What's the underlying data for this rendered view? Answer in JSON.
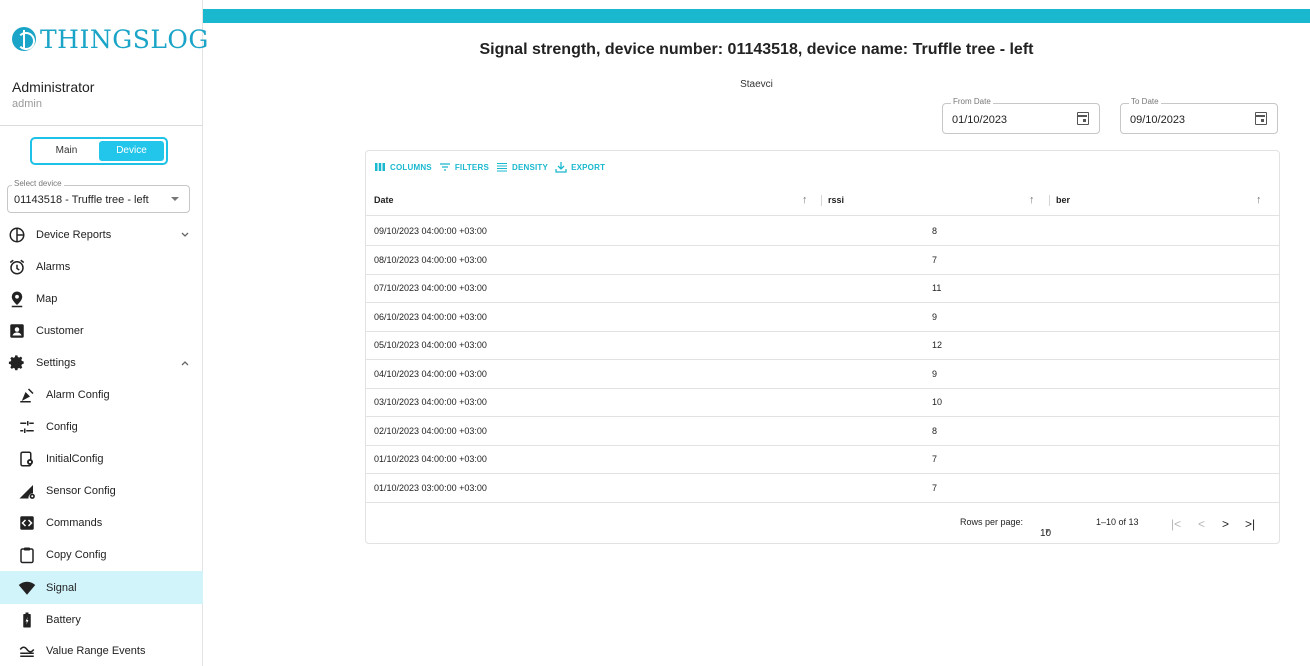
{
  "brand": {
    "name": "THINGSLOG"
  },
  "user": {
    "name": "Administrator",
    "login": "admin"
  },
  "mode_toggle": {
    "main_label": "Main",
    "device_label": "Device",
    "active": "Device"
  },
  "device_select": {
    "label": "Select device",
    "value": "01143518 - Truffle tree - left"
  },
  "nav": {
    "device_reports": "Device Reports",
    "alarms": "Alarms",
    "map": "Map",
    "customer": "Customer",
    "settings": "Settings",
    "alarm_config": "Alarm Config",
    "config": "Config",
    "initial_config": "InitialConfig",
    "sensor_config": "Sensor Config",
    "commands": "Commands",
    "copy_config": "Copy Config",
    "signal": "Signal",
    "battery": "Battery",
    "value_range_events": "Value Range Events"
  },
  "page": {
    "title": "Signal strength, device number: 01143518, device name: Truffle tree - left",
    "subtitle": "Staevci"
  },
  "filters": {
    "from_label": "From Date",
    "from_value": "01/10/2023",
    "to_label": "To Date",
    "to_value": "09/10/2023"
  },
  "toolbar": {
    "columns": "COLUMNS",
    "filters": "FILTERS",
    "density": "DENSITY",
    "export": "EXPORT"
  },
  "table": {
    "headers": {
      "date": "Date",
      "rssi": "rssi",
      "ber": "ber"
    },
    "rows": [
      {
        "date": "09/10/2023 04:00:00 +03:00",
        "rssi": "8",
        "ber": ""
      },
      {
        "date": "08/10/2023 04:00:00 +03:00",
        "rssi": "7",
        "ber": ""
      },
      {
        "date": "07/10/2023 04:00:00 +03:00",
        "rssi": "11",
        "ber": ""
      },
      {
        "date": "06/10/2023 04:00:00 +03:00",
        "rssi": "9",
        "ber": ""
      },
      {
        "date": "05/10/2023 04:00:00 +03:00",
        "rssi": "12",
        "ber": ""
      },
      {
        "date": "04/10/2023 04:00:00 +03:00",
        "rssi": "9",
        "ber": ""
      },
      {
        "date": "03/10/2023 04:00:00 +03:00",
        "rssi": "10",
        "ber": ""
      },
      {
        "date": "02/10/2023 04:00:00 +03:00",
        "rssi": "8",
        "ber": ""
      },
      {
        "date": "01/10/2023 04:00:00 +03:00",
        "rssi": "7",
        "ber": ""
      },
      {
        "date": "01/10/2023 03:00:00 +03:00",
        "rssi": "7",
        "ber": ""
      }
    ]
  },
  "pagination": {
    "rows_per_page_label": "Rows per page:",
    "rows_per_page_value": "10",
    "range": "1–10 of 13"
  },
  "colors": {
    "accent": "#1ab8cf",
    "active_bg": "#d1f4fb"
  }
}
